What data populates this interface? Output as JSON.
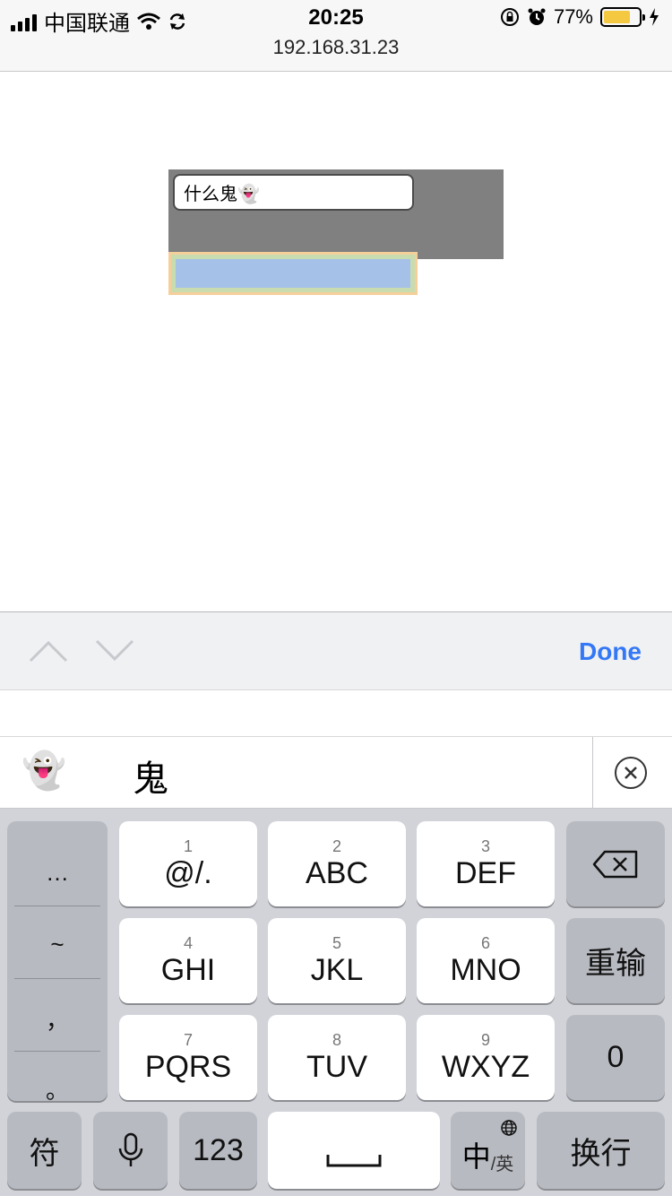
{
  "status": {
    "carrier": "中国联通",
    "time": "20:25",
    "battery": "77%",
    "battery_level": 0.77,
    "url": "192.168.31.23"
  },
  "page": {
    "input_value": "什么鬼👻"
  },
  "accessory": {
    "done_label": "Done"
  },
  "candidates": {
    "items": [
      "👻",
      "鬼"
    ]
  },
  "keyboard": {
    "punct": [
      "…",
      "~",
      "，",
      "。"
    ],
    "keys": [
      {
        "num": "1",
        "label": "@/."
      },
      {
        "num": "2",
        "label": "ABC"
      },
      {
        "num": "3",
        "label": "DEF"
      },
      {
        "num": "4",
        "label": "GHI"
      },
      {
        "num": "5",
        "label": "JKL"
      },
      {
        "num": "6",
        "label": "MNO"
      },
      {
        "num": "7",
        "label": "PQRS"
      },
      {
        "num": "8",
        "label": "TUV"
      },
      {
        "num": "9",
        "label": "WXYZ"
      }
    ],
    "reinput": "重输",
    "zero": "0",
    "symbols": "符",
    "numbers": "123",
    "lang_main": "中",
    "lang_sub": "/英",
    "return_label": "换行"
  },
  "colors": {
    "accent": "#3478f6",
    "battery": "#f5c842",
    "gray_box": "#808080",
    "keyboard_bg": "#d1d3d9"
  }
}
